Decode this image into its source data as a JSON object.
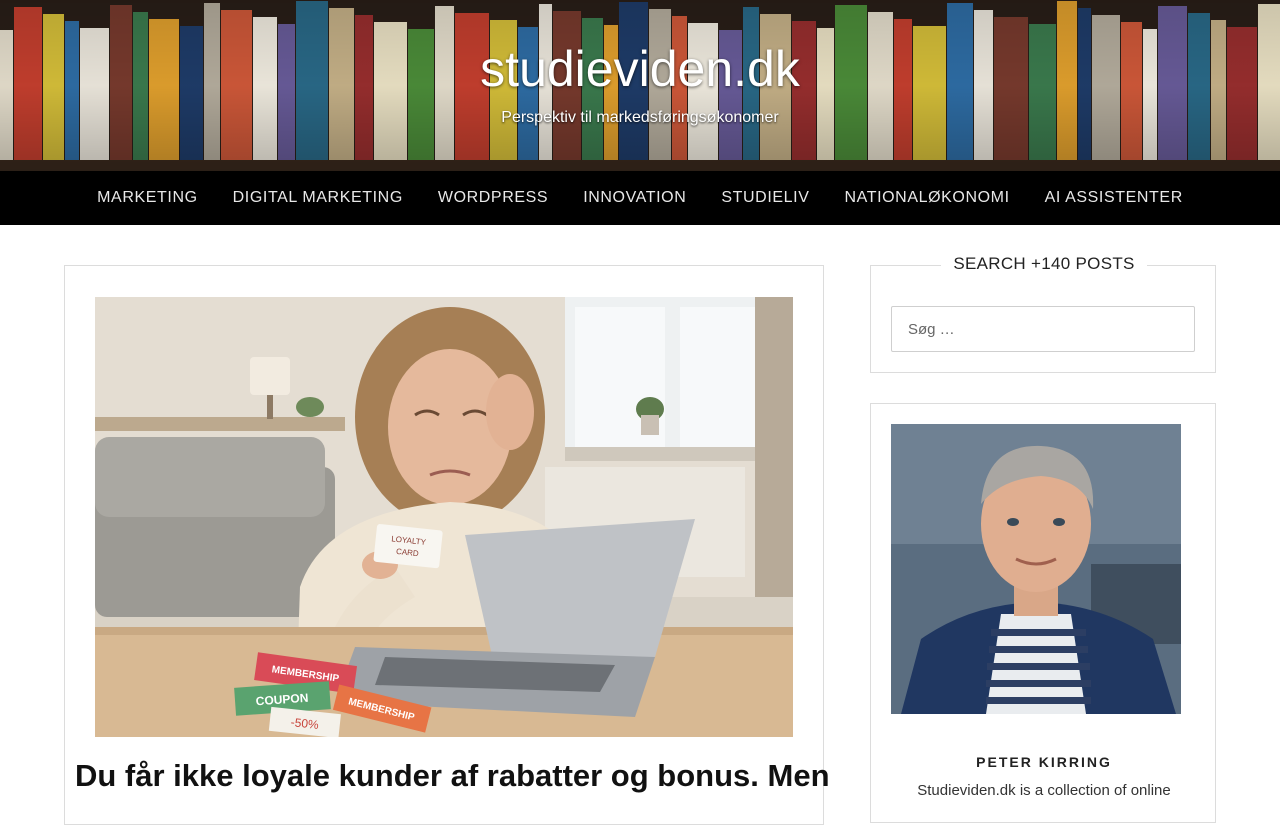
{
  "header": {
    "site_title": "studieviden.dk",
    "site_description": "Perspektiv til markedsføringsøkonomer"
  },
  "nav": {
    "items": [
      {
        "label": "MARKETING"
      },
      {
        "label": "DIGITAL MARKETING"
      },
      {
        "label": "WORDPRESS"
      },
      {
        "label": "INNOVATION"
      },
      {
        "label": "STUDIELIV"
      },
      {
        "label": "NATIONALØKONOMI"
      },
      {
        "label": "AI ASSISTENTER"
      }
    ]
  },
  "post": {
    "title": "Du får ikke loyale kunder af rabatter og bonus. Men",
    "image_labels": {
      "card": "LOYALTY CARD",
      "card_line1": "LOYALTY",
      "card_line2": "CARD",
      "membership_1": "MEMBERSHIP",
      "coupon": "COUPON",
      "discount": "-50%",
      "membership_2": "MEMBERSHIP"
    }
  },
  "sidebar": {
    "search_widget": {
      "title": "SEARCH +140 POSTS",
      "placeholder": "Søg …"
    },
    "author_widget": {
      "name": "PETER KIRRING",
      "bio": "Studieviden.dk is a collection of online"
    }
  },
  "colors": {
    "nav_bg": "#000000",
    "nav_text": "#e8e8e8",
    "border": "#dcdcdc"
  }
}
